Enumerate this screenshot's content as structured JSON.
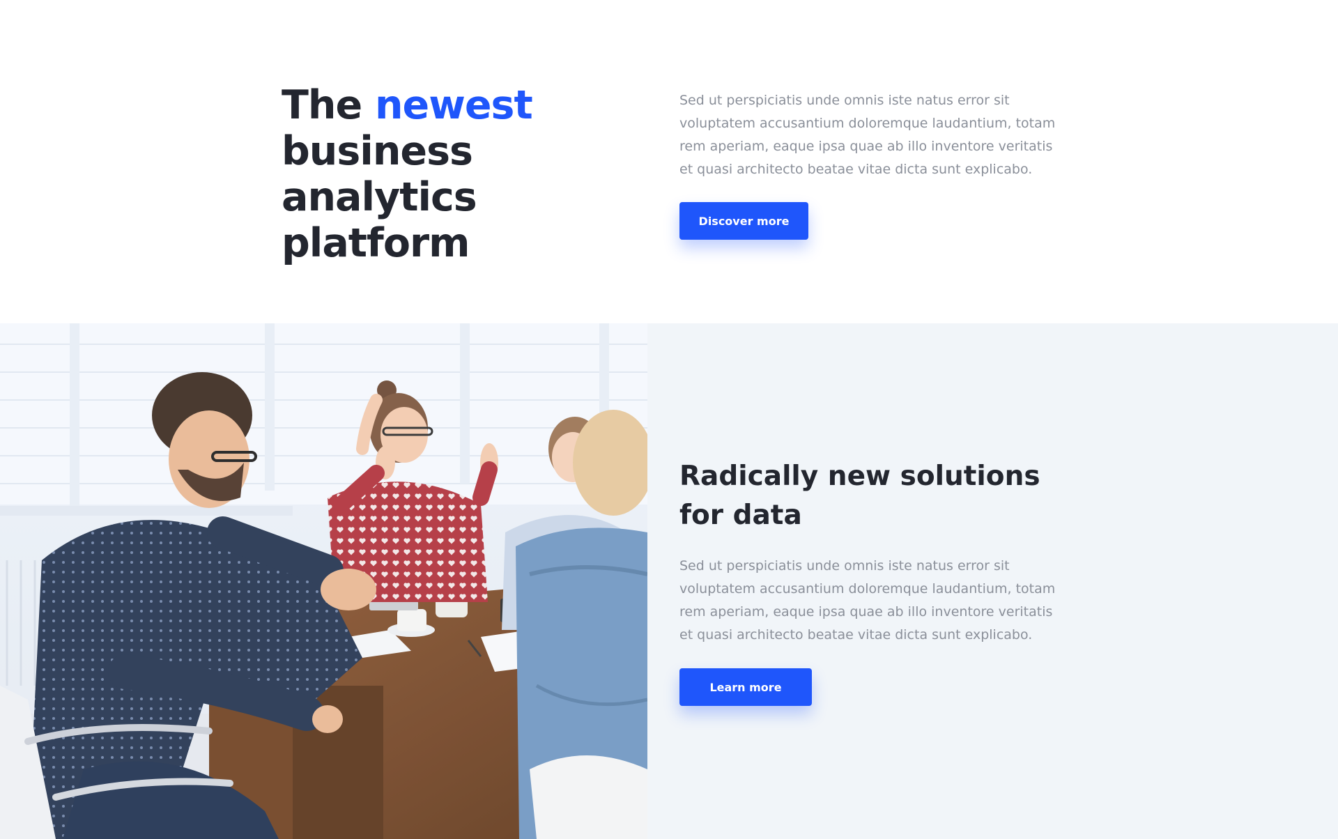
{
  "hero": {
    "title_prefix": "The ",
    "title_accent": "newest",
    "title_rest": "business analytics platform",
    "description": "Sed ut perspiciatis unde omnis iste natus error sit voluptatem accusantium doloremque laudantium, totam rem aperiam, eaque ipsa quae ab illo inventore veritatis et quasi architecto beatae vitae dicta sunt explicabo.",
    "cta_label": "Discover more"
  },
  "feature": {
    "image_icon": "team-meeting-photo",
    "title": "Radically new solutions for data",
    "description": "Sed ut perspiciatis unde omnis iste natus error sit voluptatem accusantium doloremque laudantium, totam rem aperiam, eaque ipsa quae ab illo inventore veritatis et quasi architecto beatae vitae dicta sunt explicabo.",
    "cta_label": "Learn more"
  },
  "colors": {
    "accent": "#1f56fb",
    "heading": "#23262f",
    "body_text": "#8a8f99",
    "section_bg": "#f1f5f9"
  }
}
